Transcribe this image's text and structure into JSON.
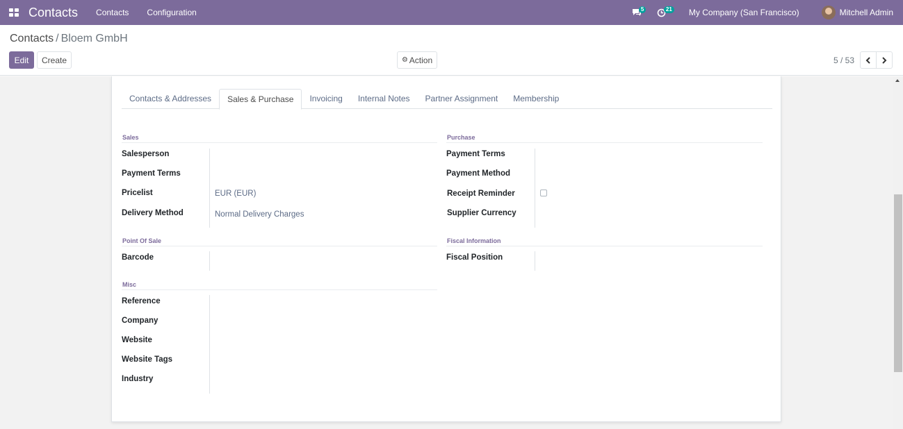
{
  "navbar": {
    "app_name": "Contacts",
    "menu": [
      "Contacts",
      "Configuration"
    ],
    "messages_count": "5",
    "activities_count": "21",
    "company": "My Company (San Francisco)",
    "user": "Mitchell Admin",
    "color": "#7c6b9b"
  },
  "breadcrumb": {
    "parent": "Contacts",
    "separator": "/",
    "current": "Bloem GmbH"
  },
  "buttons": {
    "edit": "Edit",
    "create": "Create",
    "action": "Action"
  },
  "pager": {
    "value": "5 / 53"
  },
  "tabs": [
    "Contacts & Addresses",
    "Sales & Purchase",
    "Invoicing",
    "Internal Notes",
    "Partner Assignment",
    "Membership"
  ],
  "active_tab": "Sales & Purchase",
  "sales": {
    "title": "Sales",
    "fields": [
      {
        "label": "Salesperson",
        "value": ""
      },
      {
        "label": "Payment Terms",
        "value": ""
      },
      {
        "label": "Pricelist",
        "value": "EUR (EUR)"
      },
      {
        "label": "Delivery Method",
        "value": "Normal Delivery Charges"
      }
    ]
  },
  "purchase": {
    "title": "Purchase",
    "fields": [
      {
        "label": "Payment Terms",
        "value": ""
      },
      {
        "label": "Payment Method",
        "value": ""
      },
      {
        "label": "Receipt Reminder",
        "value": "",
        "checked": false
      },
      {
        "label": "Supplier Currency",
        "value": ""
      }
    ]
  },
  "point_of_sale": {
    "title": "Point Of Sale",
    "fields": [
      {
        "label": "Barcode",
        "value": ""
      }
    ]
  },
  "fiscal": {
    "title": "Fiscal Information",
    "fields": [
      {
        "label": "Fiscal Position",
        "value": ""
      }
    ]
  },
  "misc": {
    "title": "Misc",
    "fields": [
      {
        "label": "Reference",
        "value": ""
      },
      {
        "label": "Company",
        "value": ""
      },
      {
        "label": "Website",
        "value": ""
      },
      {
        "label": "Website Tags",
        "value": ""
      },
      {
        "label": "Industry",
        "value": ""
      }
    ]
  }
}
